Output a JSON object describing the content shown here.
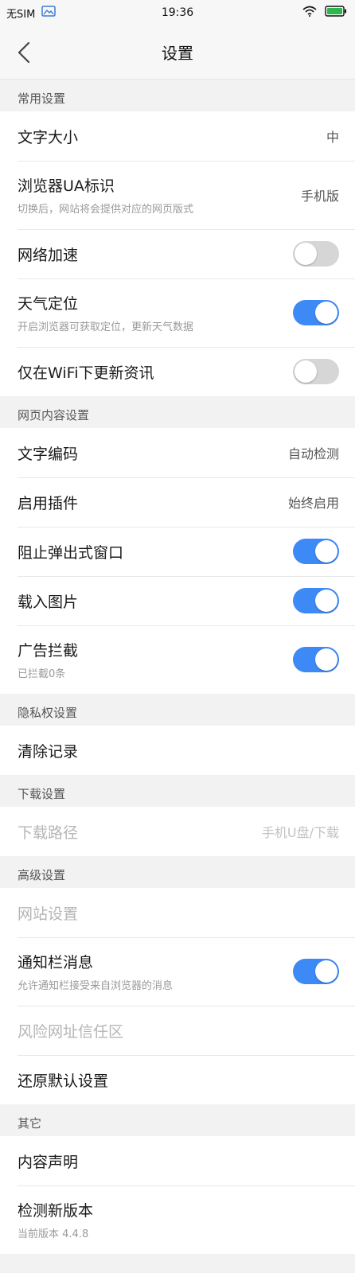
{
  "colors": {
    "accent": "#3d8af7",
    "toggle_off": "#d6d6d6",
    "background": "#f2f2f2"
  },
  "status_bar": {
    "carrier": "无SIM",
    "time": "19:36",
    "icons": [
      "image-icon",
      "wifi-icon",
      "battery-icon"
    ]
  },
  "nav": {
    "back_icon": "chevron-left-icon",
    "title": "设置"
  },
  "sections": {
    "common": {
      "header": "常用设置",
      "font_size": {
        "label": "文字大小",
        "value": "中"
      },
      "ua": {
        "label": "浏览器UA标识",
        "sub": "切换后，网站将会提供对应的网页版式",
        "value": "手机版"
      },
      "network_accel": {
        "label": "网络加速",
        "enabled": false
      },
      "weather_location": {
        "label": "天气定位",
        "sub": "开启浏览器可获取定位，更新天气数据",
        "enabled": true
      },
      "wifi_only": {
        "label": "仅在WiFi下更新资讯",
        "enabled": false
      }
    },
    "web_content": {
      "header": "网页内容设置",
      "encoding": {
        "label": "文字编码",
        "value": "自动检测"
      },
      "plugins": {
        "label": "启用插件",
        "value": "始终启用"
      },
      "block_popups": {
        "label": "阻止弹出式窗口",
        "enabled": true
      },
      "load_images": {
        "label": "载入图片",
        "enabled": true
      },
      "ad_block": {
        "label": "广告拦截",
        "sub": "已拦截0条",
        "enabled": true
      }
    },
    "privacy": {
      "header": "隐私权设置",
      "clear_history": {
        "label": "清除记录"
      }
    },
    "download": {
      "header": "下载设置",
      "path": {
        "label": "下载路径",
        "value": "手机U盘/下载"
      }
    },
    "advanced": {
      "header": "高级设置",
      "site_settings": {
        "label": "网站设置"
      },
      "notifications": {
        "label": "通知栏消息",
        "sub": "允许通知栏接受来自浏览器的消息",
        "enabled": true
      },
      "risky_trust": {
        "label": "风险网址信任区"
      },
      "restore_defaults": {
        "label": "还原默认设置"
      }
    },
    "other": {
      "header": "其它",
      "content_statement": {
        "label": "内容声明"
      },
      "check_update": {
        "label": "检测新版本",
        "sub": "当前版本 4.4.8"
      }
    }
  }
}
